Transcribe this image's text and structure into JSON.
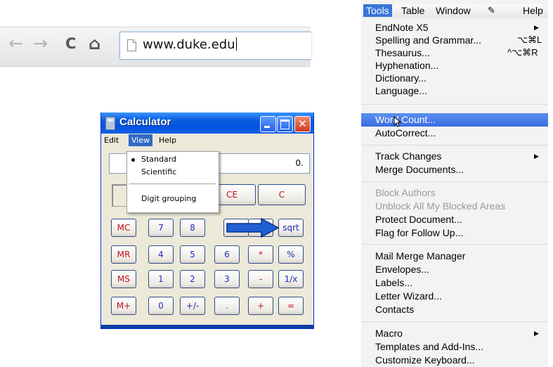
{
  "browser": {
    "back_glyph": "←",
    "forward_glyph": "→",
    "reload_glyph": "C",
    "home_glyph": "⌂",
    "url": "www.duke.edu"
  },
  "calculator": {
    "title": "Calculator",
    "menus": [
      "Edit",
      "View",
      "Help"
    ],
    "display_value": "0.",
    "view_menu": {
      "items": [
        "Standard",
        "Scientific",
        "Digit grouping"
      ],
      "checked": "Standard"
    },
    "top_buttons": [
      "CE",
      "C"
    ],
    "rows": [
      [
        "MC",
        "7",
        "8",
        "",
        "",
        "sqrt"
      ],
      [
        "MR",
        "4",
        "5",
        "6",
        "*",
        "%"
      ],
      [
        "MS",
        "1",
        "2",
        "3",
        "-",
        "1/x"
      ],
      [
        "M+",
        "0",
        "+/-",
        ".",
        "+",
        "="
      ]
    ],
    "accent_color": "#0054e3",
    "arrow_color": "#1f5fd6"
  },
  "word_menu": {
    "menubar": [
      "Tools",
      "Table",
      "Window",
      "Help"
    ],
    "groups": [
      [
        {
          "label": "EndNote X5",
          "submenu": true
        },
        {
          "label": "Spelling and Grammar...",
          "shortcut": "⌥⌘L"
        },
        {
          "label": "Thesaurus...",
          "shortcut": "^⌥⌘R"
        },
        {
          "label": "Hyphenation..."
        },
        {
          "label": "Dictionary..."
        },
        {
          "label": "Language..."
        }
      ],
      [
        {
          "label": "Word Count...",
          "highlighted": true
        },
        {
          "label": "AutoCorrect..."
        }
      ],
      [
        {
          "label": "Track Changes",
          "submenu": true
        },
        {
          "label": "Merge Documents..."
        }
      ],
      [
        {
          "label": "Block Authors",
          "disabled": true
        },
        {
          "label": "Unblock All My Blocked Areas",
          "disabled": true
        },
        {
          "label": "Protect Document..."
        },
        {
          "label": "Flag for Follow Up..."
        }
      ],
      [
        {
          "label": "Mail Merge Manager"
        },
        {
          "label": "Envelopes..."
        },
        {
          "label": "Labels..."
        },
        {
          "label": "Letter Wizard..."
        },
        {
          "label": "Contacts"
        }
      ],
      [
        {
          "label": "Macro",
          "submenu": true
        },
        {
          "label": "Templates and Add-Ins..."
        },
        {
          "label": "Customize Keyboard..."
        }
      ]
    ],
    "highlight_color": "#3a6de0"
  }
}
